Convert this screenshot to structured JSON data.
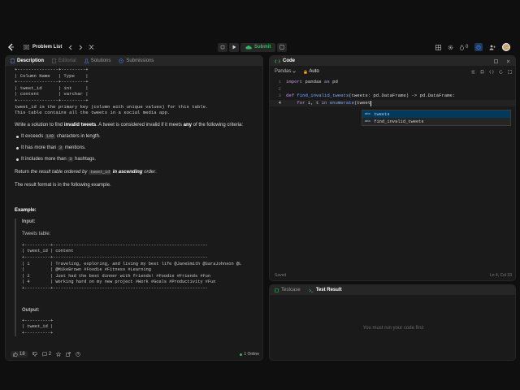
{
  "topbar": {
    "problem_list": "Problem List",
    "submit": "Submit",
    "fire_count": "0"
  },
  "left": {
    "tabs": [
      "Description",
      "Editorial",
      "Solutions",
      "Submissions"
    ],
    "schema_table": "+---------------+---------+\n| Column Name   | Type    |\n+---------------+---------+\n| tweet_id      | int     |\n| content       | varchar |\n+---------------+---------+",
    "schema_note": "tweet_id is the primary key (column with unique values) for this table.\nThis table contains all the tweets in a social media app.",
    "p1_a": "Write a solution to find ",
    "p1_b": "invalid tweets",
    "p1_c": ". A tweet is considered invalid if it meets ",
    "p1_d": "any",
    "p1_e": " of the following criteria:",
    "c1_a": "It exceeds ",
    "c1_chip": "140",
    "c1_b": " characters in length.",
    "c2_a": "It has more than ",
    "c2_chip": "3",
    "c2_b": " mentions.",
    "c3_a": "It includes more than ",
    "c3_chip": "3",
    "c3_b": " hashtags.",
    "ret_a": "Return ",
    "ret_b": "the result table ordered by ",
    "ret_chip": "tweet_id",
    "ret_c": " in ascending",
    "ret_d": " order",
    "ret_e": ".",
    "format": "The result format is in the following example.",
    "example": "Example:",
    "input": "Input:",
    "tweets_table": "Tweets table:",
    "tweets_pre": "+----------+------------------------------------------------------------\n| tweet_id | content\n+----------+------------------------------------------------------------\n| 1        | Traveling, exploring, and living my best life @JaneSmith @SaraJohnson @L\n|          | @MikeBrown #Foodie #Fitness #Learning\n| 2        | Just had the best dinner with friends! #Foodie #Friends #Fun\n| 4        | Working hard on my new project #Work #Goals #Productivity #Fun\n+----------+------------------------------------------------------------",
    "output": "Output:",
    "output_pre": "+----------+\n| tweet_id |\n+----------+",
    "likes": "18",
    "comments": "2",
    "online": "1 Online"
  },
  "code": {
    "title": "Code",
    "language": "Pandas",
    "auto": "Auto",
    "lines": [
      "1",
      "2",
      "3",
      "4"
    ],
    "l1_kw": "import",
    "l1_rest": " pandas ",
    "l1_kw2": "as",
    "l1_end": " pd",
    "l3_kw": "def",
    "l3_fn": " find_invalid_tweets",
    "l3_rest": "(tweets: pd.DataFrame) -> pd.DataFrame:",
    "l4_kw": "    for",
    "l4_a": " i, t ",
    "l4_kw2": "in",
    "l4_fn": " enumerate",
    "l4_b": "(tweet",
    "suggestions": [
      "tweets",
      "find_invalid_tweets"
    ],
    "saved": "Saved",
    "position": "Ln 4, Col 33"
  },
  "result": {
    "tab_testcase": "Testcase",
    "tab_result": "Test Result",
    "empty": "You must run your code first"
  },
  "colors": {
    "submit_green": "#2cbb5d",
    "accent_blue": "#3b82f6",
    "auto_orange": "#f5a623"
  }
}
